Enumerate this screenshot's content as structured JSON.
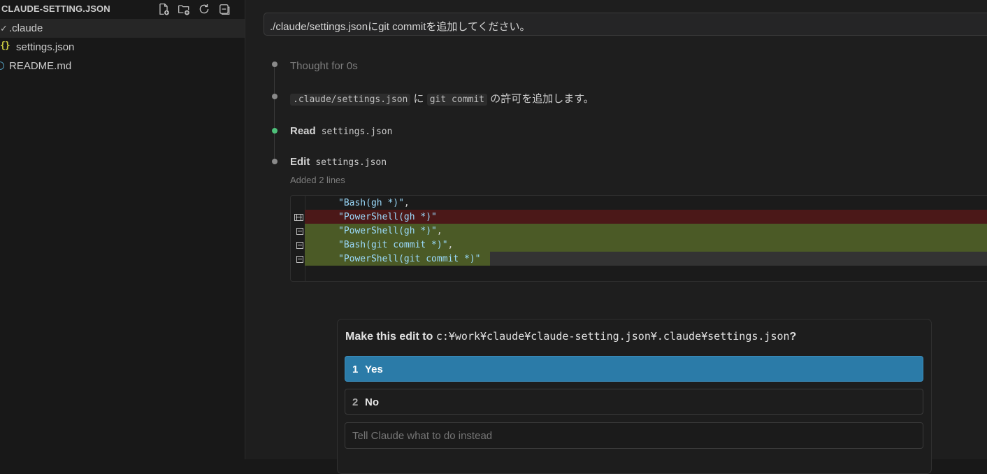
{
  "explorer": {
    "title": "CLAUDE-SETTING.JSON",
    "actions": [
      {
        "name": "new-file-icon"
      },
      {
        "name": "new-folder-icon"
      },
      {
        "name": "refresh-icon"
      },
      {
        "name": "collapse-all-icon"
      }
    ],
    "tree": [
      {
        "label": ".claude",
        "chevron": "✓",
        "type": "folder"
      },
      {
        "label": "settings.json",
        "icon": "{}",
        "type": "json"
      },
      {
        "label": "README.md",
        "type": "info"
      }
    ]
  },
  "chat": {
    "prompt": "./claude/settings.jsonにgit commitを追加してください。",
    "steps": {
      "thought": "Thought for 0s",
      "intro_file": ".claude/settings.json",
      "intro_ni": "に",
      "intro_cmd": "git commit",
      "intro_rest": "の許可を追加します。",
      "read_label": "Read",
      "read_file": "settings.json",
      "edit_label": "Edit",
      "edit_file": "settings.json",
      "edit_summary": "Added 2 lines"
    },
    "diff": [
      {
        "type": "context",
        "text": "\"Bash(gh *)\"",
        "trail": ","
      },
      {
        "type": "removed",
        "marker": "[⊠",
        "text": "\"PowerShell(gh *)\"",
        "trail": ""
      },
      {
        "type": "added",
        "marker": "⊠",
        "text": "\"PowerShell(gh *)\"",
        "trail": ","
      },
      {
        "type": "added",
        "marker": "⊠",
        "text": "\"Bash(git commit *)\"",
        "trail": ","
      },
      {
        "type": "added",
        "marker": "⊠",
        "text": "\"PowerShell(git commit *)\"",
        "trail": ""
      }
    ],
    "permission": {
      "title_prefix": "Make this edit to",
      "title_path": "c:¥work¥claude¥claude-setting.json¥.claude¥settings.json",
      "title_suffix": "?",
      "options": [
        {
          "num": "1",
          "label": "Yes",
          "selected": true
        },
        {
          "num": "2",
          "label": "No",
          "selected": false
        }
      ],
      "input_placeholder": "Tell Claude what to do instead"
    }
  },
  "colors": {
    "background": "#181818",
    "accent": "#2b7ba8",
    "diff_removed": "#4b1818",
    "diff_added": "#4b5a26",
    "dot_success": "#4ec07a",
    "json_icon": "#cbcb41"
  }
}
